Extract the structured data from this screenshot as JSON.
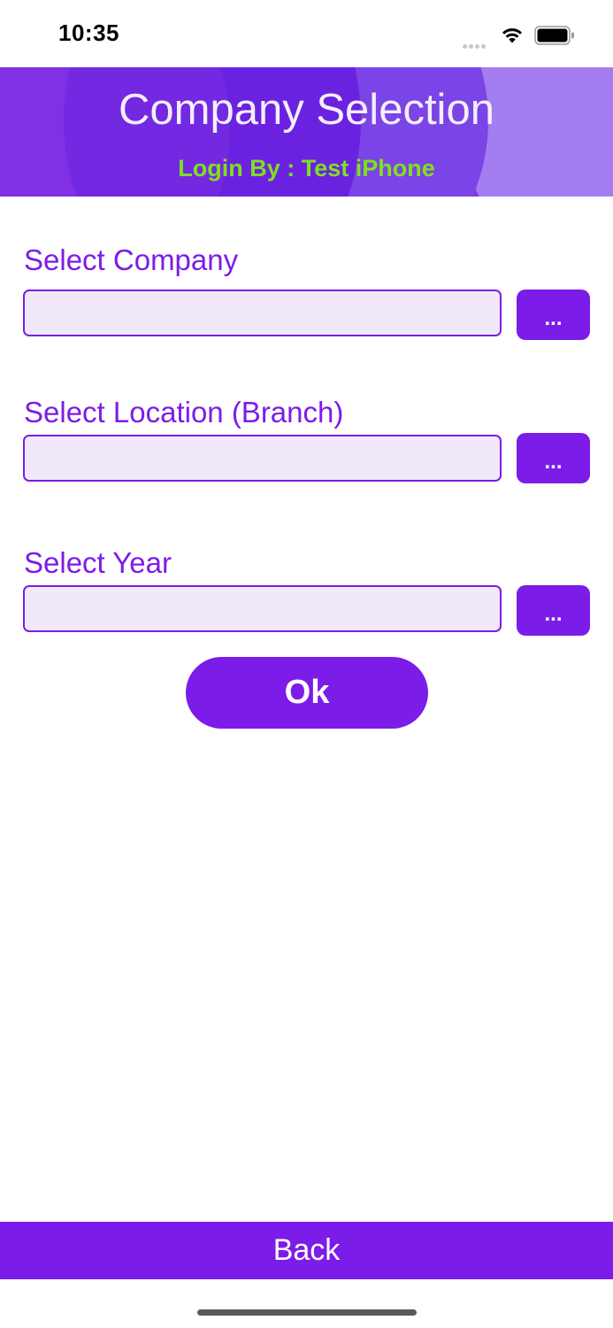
{
  "status_bar": {
    "time": "10:35",
    "icons": [
      "signal-dots-icon",
      "wifi-icon",
      "battery-icon"
    ]
  },
  "header": {
    "title": "Company Selection",
    "subtitle": "Login By : Test iPhone"
  },
  "form": {
    "company": {
      "label": "Select Company",
      "value": "",
      "button_label": "..."
    },
    "location": {
      "label": "Select Location (Branch)",
      "value": "",
      "button_label": "..."
    },
    "year": {
      "label": "Select Year",
      "value": "",
      "button_label": "..."
    },
    "ok_label": "Ok"
  },
  "footer": {
    "back_label": "Back"
  },
  "colors": {
    "accent": "#7c1ce8",
    "input_fill": "#f1e9fa",
    "subtitle": "#7fe01f",
    "header_title": "#f4eefc"
  }
}
